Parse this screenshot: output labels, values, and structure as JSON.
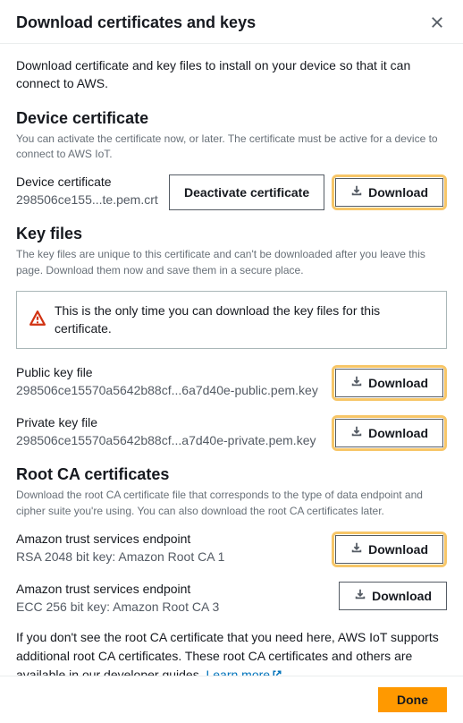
{
  "title": "Download certificates and keys",
  "intro": "Download certificate and key files to install on your device so that it can connect to AWS.",
  "device_cert": {
    "heading": "Device certificate",
    "sub": "You can activate the certificate now, or later. The certificate must be active for a device to connect to AWS IoT.",
    "label": "Device certificate",
    "value": "298506ce155...te.pem.crt",
    "deactivate": "Deactivate certificate",
    "download": "Download"
  },
  "key_files": {
    "heading": "Key files",
    "sub": "The key files are unique to this certificate and can't be downloaded after you leave this page. Download them now and save them in a secure place.",
    "alert": "This is the only time you can download the key files for this certificate.",
    "public": {
      "label": "Public key file",
      "value": "298506ce15570a5642b88cf...6a7d40e-public.pem.key",
      "download": "Download"
    },
    "private": {
      "label": "Private key file",
      "value": "298506ce15570a5642b88cf...a7d40e-private.pem.key",
      "download": "Download"
    }
  },
  "root_ca": {
    "heading": "Root CA certificates",
    "sub": "Download the root CA certificate file that corresponds to the type of data endpoint and cipher suite you're using. You can also download the root CA certificates later.",
    "ca1": {
      "label": "Amazon trust services endpoint",
      "value": "RSA 2048 bit key: Amazon Root CA 1",
      "download": "Download"
    },
    "ca3": {
      "label": "Amazon trust services endpoint",
      "value": "ECC 256 bit key: Amazon Root CA 3",
      "download": "Download"
    },
    "foot_a": "If you don't see the root CA certificate that you need here, AWS IoT supports additional root CA certificates. These root CA certificates and others are available in our developer guides. ",
    "learn": "Learn more"
  },
  "done": "Done"
}
